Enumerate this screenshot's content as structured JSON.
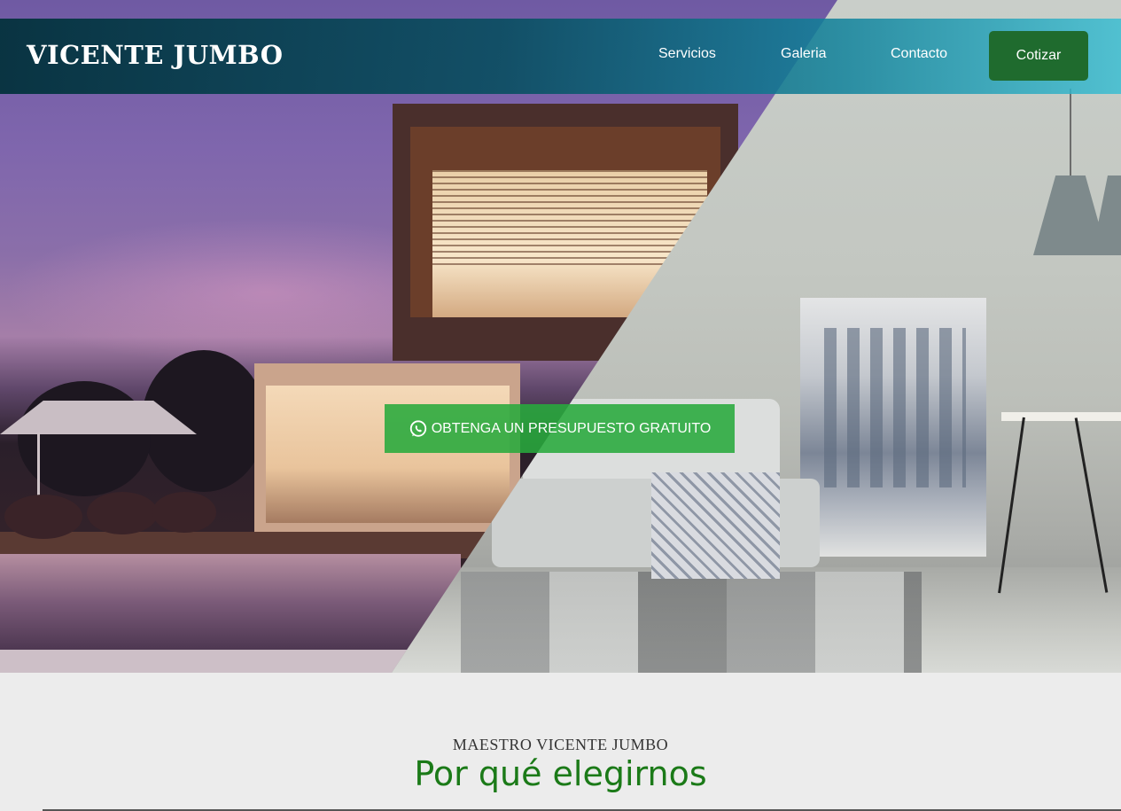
{
  "brand": {
    "logo_text": "VICENTE JUMBO"
  },
  "nav": {
    "links": [
      {
        "label": "Servicios"
      },
      {
        "label": "Galeria"
      },
      {
        "label": "Contacto"
      }
    ],
    "cta_label": "Cotizar"
  },
  "hero": {
    "cta_label": "OBTENGA UN PRESUPUESTO GRATUITO",
    "cta_icon": "whatsapp-icon"
  },
  "section": {
    "eyebrow": "MAESTRO VICENTE JUMBO",
    "title": "Por qué elegirnos"
  },
  "colors": {
    "nav_cta": "#1f6b2e",
    "hero_cta": "#28aa3c",
    "section_title": "#1b7a18",
    "section_bg": "#ececec"
  }
}
